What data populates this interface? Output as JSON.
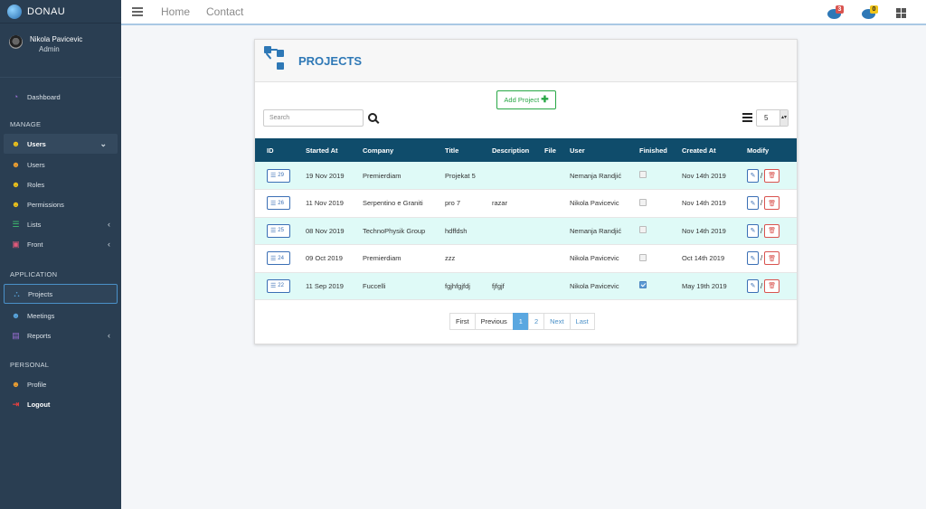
{
  "app": {
    "name": "DONAU"
  },
  "user": {
    "name": "Nikola Pavicevic",
    "role": "Admin"
  },
  "sidebar": {
    "dashboard": "Dashboard",
    "manage_label": "MANAGE",
    "users_group": "Users",
    "users": "Users",
    "roles": "Roles",
    "permissions": "Permissions",
    "lists": "Lists",
    "front": "Front",
    "application_label": "APPLICATION",
    "projects": "Projects",
    "meetings": "Meetings",
    "reports": "Reports",
    "personal_label": "PERSONAL",
    "profile": "Profile",
    "logout": "Logout"
  },
  "topbar": {
    "home": "Home",
    "contact": "Contact",
    "messages_count": "3",
    "notifications_count": "0"
  },
  "page": {
    "title": "PROJECTS",
    "add_label": "Add Project",
    "search_placeholder": "Search",
    "page_size": "5"
  },
  "table": {
    "headers": [
      "ID",
      "Started At",
      "Company",
      "Title",
      "Description",
      "File",
      "User",
      "Finished",
      "Created At",
      "Modify"
    ],
    "rows": [
      {
        "id": "29",
        "started": "19 Nov 2019",
        "company": "Premierdiam",
        "title": "Projekat 5",
        "description": "",
        "file": "",
        "user": "Nemanja Randjić",
        "finished": false,
        "created": "Nov 14th 2019"
      },
      {
        "id": "26",
        "started": "11 Nov 2019",
        "company": "Serpentino e Graniti",
        "title": "pro 7",
        "description": "razar",
        "file": "",
        "user": "Nikola Pavicevic",
        "finished": false,
        "created": "Nov 14th 2019"
      },
      {
        "id": "25",
        "started": "08 Nov 2019",
        "company": "TechnoPhysik Group",
        "title": "hdffdsh",
        "description": "",
        "file": "",
        "user": "Nemanja Randjić",
        "finished": false,
        "created": "Nov 14th 2019"
      },
      {
        "id": "24",
        "started": "09 Oct 2019",
        "company": "Premierdiam",
        "title": "zzz",
        "description": "",
        "file": "",
        "user": "Nikola Pavicevic",
        "finished": false,
        "created": "Oct 14th 2019"
      },
      {
        "id": "22",
        "started": "11 Sep 2019",
        "company": "Fuccelli",
        "title": "fgjhfgjfdj",
        "description": "fjfgjf",
        "file": "",
        "user": "Nikola Pavicevic",
        "finished": true,
        "created": "May 19th 2019"
      }
    ]
  },
  "pagination": {
    "first": "First",
    "previous": "Previous",
    "pages": [
      "1",
      "2"
    ],
    "current": "1",
    "next": "Next",
    "last": "Last"
  },
  "colors": {
    "sidebar_bg": "#2a3e52",
    "table_header": "#0f4c6b",
    "accent": "#2e78b6",
    "row_alt": "#dffaf7",
    "success": "#28a745",
    "danger": "#d9534f"
  }
}
